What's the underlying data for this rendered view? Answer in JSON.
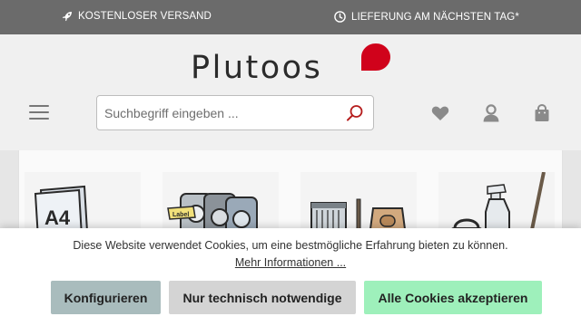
{
  "topbar": {
    "shipping": {
      "icon": "rocket-icon",
      "label": "KOSTENLOSER VERSAND"
    },
    "delivery": {
      "icon": "clock-icon",
      "label": "LIEFERUNG AM NÄCHSTEN TAG*"
    }
  },
  "header": {
    "logo_text": "Plutoos",
    "brand_color": "#d0021b",
    "search": {
      "placeholder": "Suchbegriff eingeben ...",
      "value": ""
    },
    "icons": [
      "menu-icon",
      "search-icon",
      "heart-icon",
      "user-icon",
      "bag-icon"
    ]
  },
  "categories": [
    {
      "icon": "a4-paper-icon"
    },
    {
      "icon": "label-tape-icon"
    },
    {
      "icon": "vacuum-filter-bag-icon"
    },
    {
      "icon": "cleaning-supplies-icon"
    }
  ],
  "cookie_banner": {
    "message": "Diese Website verwendet Cookies, um eine bestmögliche Erfahrung bieten zu können.",
    "more_link": "Mehr Informationen ...",
    "buttons": {
      "configure": "Konfigurieren",
      "technical": "Nur technisch notwendige",
      "accept_all": "Alle Cookies akzeptieren"
    },
    "colors": {
      "configure": "#a9bcbd",
      "technical": "#d4d4d4",
      "accept_all": "#9ef0bb"
    }
  }
}
